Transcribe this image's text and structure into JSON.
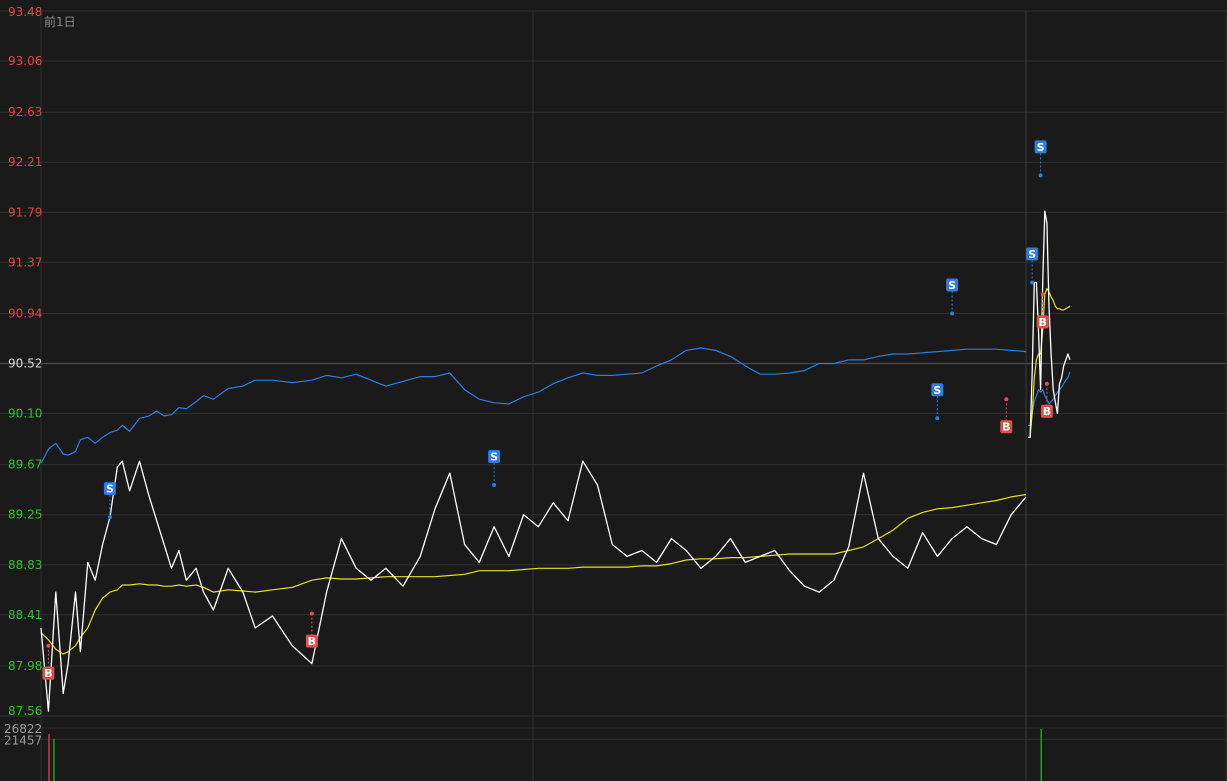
{
  "chart_data": {
    "type": "line",
    "period_label": "前1日",
    "y_range": [
      87.56,
      93.48
    ],
    "y_ticks": [
      "93.48",
      "93.06",
      "92.63",
      "92.21",
      "91.79",
      "91.37",
      "90.94",
      "90.52",
      "90.10",
      "89.67",
      "89.25",
      "88.83",
      "88.41",
      "87.98",
      "87.56"
    ],
    "baseline_price": 90.52,
    "volume_ticks": [
      "26822",
      "21457"
    ],
    "volume_range": [
      0,
      26822
    ],
    "sessions": [
      {
        "name": "session-1",
        "x": [
          0,
          1.5,
          3,
          4.5,
          5.5,
          7,
          8,
          9.5,
          11,
          12.5,
          14,
          15.5,
          16.5,
          18,
          20,
          22,
          23.5,
          25,
          26.5,
          28,
          29.5,
          31.5,
          33,
          35,
          38,
          41,
          43.5,
          47,
          51,
          55,
          58,
          61,
          64,
          67,
          70,
          73.5,
          77,
          80,
          83,
          86,
          89,
          92,
          95,
          98,
          101,
          104,
          107,
          110,
          113,
          116,
          119,
          122,
          125,
          128,
          131,
          134,
          137,
          140,
          143,
          146,
          149,
          152,
          155,
          158,
          161,
          164,
          167,
          170,
          173,
          176,
          179,
          182,
          185,
          188,
          191,
          194,
          197,
          200
        ],
        "price": [
          88.3,
          87.6,
          88.6,
          87.75,
          88.0,
          88.6,
          88.1,
          88.85,
          88.7,
          89.0,
          89.23,
          89.65,
          89.7,
          89.45,
          89.7,
          89.4,
          89.2,
          89.0,
          88.8,
          88.95,
          88.7,
          88.8,
          88.6,
          88.45,
          88.8,
          88.6,
          88.3,
          88.4,
          88.15,
          88.0,
          88.6,
          89.05,
          88.8,
          88.7,
          88.8,
          88.65,
          88.9,
          89.3,
          89.6,
          89.0,
          88.85,
          89.15,
          88.9,
          89.25,
          89.15,
          89.35,
          89.2,
          89.7,
          89.5,
          89.0,
          88.9,
          88.95,
          88.85,
          89.05,
          88.95,
          88.8,
          88.9,
          89.05,
          88.85,
          88.9,
          88.95,
          88.78,
          88.65,
          88.6,
          88.7,
          88.98,
          89.6,
          89.05,
          88.9,
          88.8,
          89.1,
          88.9,
          89.05,
          89.15,
          89.05,
          89.0,
          89.25,
          89.4
        ],
        "avg_price": [
          88.26,
          88.2,
          88.12,
          88.08,
          88.1,
          88.15,
          88.22,
          88.3,
          88.45,
          88.55,
          88.6,
          88.62,
          88.66,
          88.66,
          88.67,
          88.66,
          88.66,
          88.65,
          88.65,
          88.66,
          88.65,
          88.66,
          88.64,
          88.6,
          88.62,
          88.61,
          88.6,
          88.62,
          88.64,
          88.7,
          88.72,
          88.71,
          88.71,
          88.72,
          88.73,
          88.73,
          88.73,
          88.73,
          88.74,
          88.75,
          88.78,
          88.78,
          88.78,
          88.79,
          88.8,
          88.8,
          88.8,
          88.81,
          88.81,
          88.81,
          88.81,
          88.82,
          88.82,
          88.84,
          88.87,
          88.88,
          88.88,
          88.89,
          88.89,
          88.9,
          88.91,
          88.92,
          88.92,
          88.92,
          88.92,
          88.95,
          88.98,
          89.05,
          89.12,
          89.22,
          89.27,
          89.3,
          89.31,
          89.33,
          89.35,
          89.37,
          89.4,
          89.42
        ],
        "compare_line": [
          89.68,
          89.8,
          89.85,
          89.76,
          89.75,
          89.78,
          89.88,
          89.9,
          89.85,
          89.9,
          89.94,
          89.96,
          90.0,
          89.95,
          90.06,
          90.08,
          90.12,
          90.08,
          90.09,
          90.15,
          90.14,
          90.2,
          90.25,
          90.22,
          90.31,
          90.33,
          90.38,
          90.38,
          90.36,
          90.38,
          90.42,
          90.4,
          90.43,
          90.38,
          90.33,
          90.37,
          90.41,
          90.41,
          90.44,
          90.3,
          90.22,
          90.19,
          90.18,
          90.24,
          90.28,
          90.35,
          90.4,
          90.44,
          90.42,
          90.42,
          90.43,
          90.44,
          90.5,
          90.55,
          90.63,
          90.65,
          90.63,
          90.58,
          90.5,
          90.43,
          90.43,
          90.44,
          90.46,
          90.52,
          90.52,
          90.55,
          90.55,
          90.58,
          90.6,
          90.6,
          90.61,
          90.62,
          90.63,
          90.64,
          90.64,
          90.64,
          90.63,
          90.62
        ]
      },
      {
        "name": "session-2",
        "x": [
          0,
          2,
          4,
          6,
          8,
          10,
          12,
          14,
          16,
          18,
          20,
          22,
          24,
          26,
          28,
          30,
          32,
          34,
          36,
          38,
          40
        ],
        "price": [
          89.9,
          89.9,
          90.45,
          91.2,
          91.2,
          90.8,
          90.3,
          91.2,
          91.8,
          91.7,
          91.0,
          90.6,
          90.3,
          90.2,
          90.1,
          90.35,
          90.4,
          90.5,
          90.55,
          90.6,
          90.55
        ],
        "avg_price": [
          89.9,
          89.9,
          90.1,
          90.4,
          90.55,
          90.6,
          90.6,
          90.8,
          91.1,
          91.15,
          91.12,
          91.08,
          91.05,
          91.0,
          90.98,
          90.98,
          90.97,
          90.97,
          90.98,
          90.99,
          91.0
        ],
        "compare_line": [
          90.0,
          90.0,
          90.1,
          90.2,
          90.25,
          90.3,
          90.28,
          90.3,
          90.25,
          90.22,
          90.18,
          90.2,
          90.22,
          90.25,
          90.28,
          90.3,
          90.32,
          90.35,
          90.38,
          90.4,
          90.45
        ]
      }
    ],
    "signals": [
      {
        "session": 0,
        "x": 1.5,
        "price": 88.15,
        "type": "B"
      },
      {
        "session": 0,
        "x": 14,
        "price": 89.23,
        "type": "S"
      },
      {
        "session": 0,
        "x": 55,
        "price": 88.42,
        "type": "B"
      },
      {
        "session": 0,
        "x": 92,
        "price": 89.5,
        "type": "S"
      },
      {
        "session": 0,
        "x": 185,
        "price": 90.94,
        "type": "S"
      },
      {
        "session": 0,
        "x": 182,
        "price": 90.06,
        "type": "S"
      },
      {
        "session": 0,
        "x": 196,
        "price": 90.22,
        "type": "B"
      },
      {
        "session": 1,
        "x": 4,
        "price": 91.2,
        "type": "S"
      },
      {
        "session": 1,
        "x": 12,
        "price": 92.1,
        "type": "S"
      },
      {
        "session": 1,
        "x": 14,
        "price": 91.1,
        "type": "B"
      },
      {
        "session": 1,
        "x": 18,
        "price": 90.35,
        "type": "B"
      }
    ],
    "volume_bars": [
      {
        "session": 0,
        "x": 1.5,
        "value": 24200,
        "color": "#ff4040"
      },
      {
        "session": 0,
        "x": 2.5,
        "value": 21800,
        "color": "#19c419"
      },
      {
        "session": 1,
        "x": 12,
        "value": 26822,
        "color": "#19c419"
      }
    ],
    "colors": {
      "background": "#1a1a1a",
      "grid": "#2e2e2e",
      "baseline": "#4a4a4a",
      "price_line": "#ffffff",
      "avg_line": "#e8e020",
      "compare_line": "#2a7de1",
      "up_label": "#e84040",
      "down_label": "#2ec02e",
      "neutral_label": "#d8d8d8",
      "buy": "#e0504a",
      "sell": "#2a7de1",
      "volume_label": "#9a9a9a"
    }
  }
}
